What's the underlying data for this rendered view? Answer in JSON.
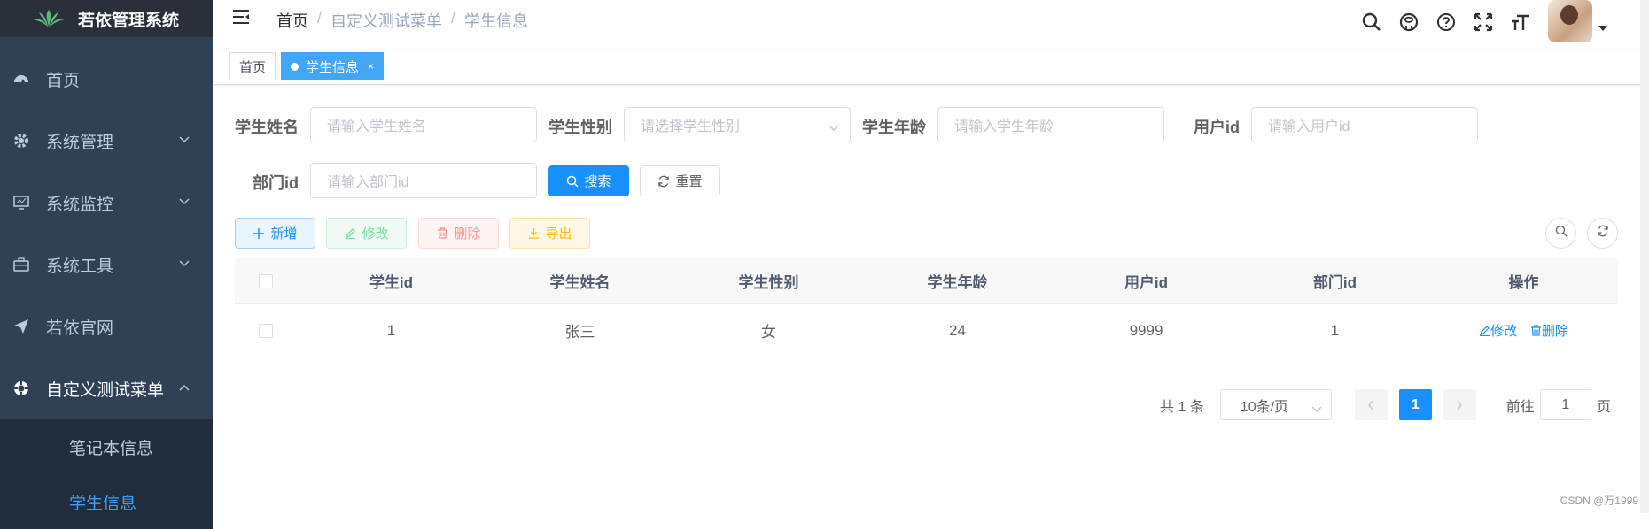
{
  "app": {
    "title": "若依管理系统"
  },
  "sidebar": {
    "items": [
      {
        "label": "首页",
        "icon": "dashboard-icon"
      },
      {
        "label": "系统管理",
        "icon": "gear-icon"
      },
      {
        "label": "系统监控",
        "icon": "monitor-icon"
      },
      {
        "label": "系统工具",
        "icon": "toolbox-icon"
      },
      {
        "label": "若依官网",
        "icon": "send-icon"
      },
      {
        "label": "自定义测试菜单",
        "icon": "lifebuoy-icon"
      }
    ],
    "submenu": [
      {
        "label": "笔记本信息"
      },
      {
        "label": "学生信息"
      }
    ]
  },
  "breadcrumb": [
    "首页",
    "自定义测试菜单",
    "学生信息"
  ],
  "breadcrumb_sep": "/",
  "tags": [
    {
      "label": "首页"
    },
    {
      "label": "学生信息",
      "close": "×"
    }
  ],
  "search": {
    "name": {
      "label": "学生姓名",
      "placeholder": "请输入学生姓名"
    },
    "gender": {
      "label": "学生性别",
      "placeholder": "请选择学生性别"
    },
    "age": {
      "label": "学生年龄",
      "placeholder": "请输入学生年龄"
    },
    "user_id": {
      "label": "用户id",
      "placeholder": "请输入用户id"
    },
    "dept_id": {
      "label": "部门id",
      "placeholder": "请输入部门id"
    },
    "search_btn": "搜索",
    "reset_btn": "重置"
  },
  "toolbar": {
    "add": "新增",
    "edit": "修改",
    "delete": "删除",
    "export": "导出"
  },
  "table": {
    "columns": [
      "学生id",
      "学生姓名",
      "学生性别",
      "学生年龄",
      "用户id",
      "部门id",
      "操作"
    ],
    "rows": [
      {
        "id": "1",
        "name": "张三",
        "gender": "女",
        "age": "24",
        "user_id": "9999",
        "dept_id": "1",
        "edit": "修改",
        "delete": "删除"
      }
    ]
  },
  "pagination": {
    "total": "共 1 条",
    "page_size": "10条/页",
    "current": "1",
    "goto_label": "前往",
    "goto_value": "1",
    "page_suffix": "页"
  },
  "watermark": "CSDN @万1999",
  "colors": {
    "sidebar": "#304156",
    "primary": "#1890ff",
    "tag_active": "#42a5f5"
  }
}
